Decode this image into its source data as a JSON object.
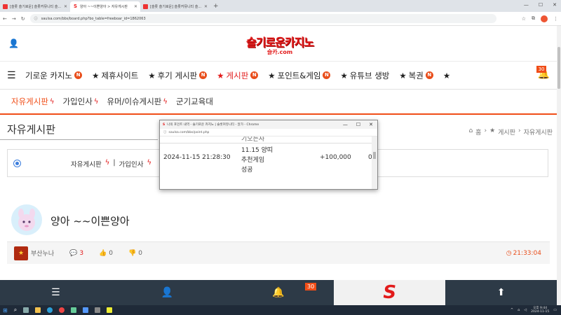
{
  "browser": {
    "tabs": [
      {
        "title": "[슬롯 슬기로운] 슬롯커뮤니티 슬...",
        "active": false,
        "favicon": "youtube-icon"
      },
      {
        "title": "양아 ~~이쁜양아 > 자유게시판",
        "active": true,
        "favicon": "s-logo-icon"
      },
      {
        "title": "[슬롯 슬기로운] 슬롯커뮤니티 슬...",
        "active": false,
        "favicon": "youtube-icon"
      }
    ],
    "url": "saulsa.com/bbs/board.php?bo_table=freeboar_id=1862063"
  },
  "site": {
    "logo_main": "슬기로운카지노",
    "logo_sub": "슬카.com"
  },
  "main_nav": [
    {
      "label": "기로운 카지노",
      "badge": "N",
      "star": false,
      "active": false
    },
    {
      "label": "제휴사이트",
      "badge": "",
      "star": true,
      "active": false
    },
    {
      "label": "후기 게시판",
      "badge": "N",
      "star": true,
      "active": false
    },
    {
      "label": "게시판",
      "badge": "N",
      "star": true,
      "active": true
    },
    {
      "label": "포인트&게임",
      "badge": "N",
      "star": true,
      "active": false
    },
    {
      "label": "유튜브 생방",
      "badge": "",
      "star": true,
      "active": false
    },
    {
      "label": "복권",
      "badge": "N",
      "star": true,
      "active": false
    }
  ],
  "notifications": {
    "count": "30"
  },
  "sub_nav": [
    {
      "label": "자유게시판",
      "active": true
    },
    {
      "label": "가입인사",
      "active": false
    },
    {
      "label": "유머/이슈게시판",
      "active": false
    },
    {
      "label": "군기교육대",
      "active": false
    }
  ],
  "board": {
    "title": "자유게시판",
    "breadcrumb": [
      "홈",
      "게시판",
      "자유게시판"
    ]
  },
  "filter": {
    "links": [
      "자유게시판",
      "가입인사"
    ],
    "separator": "|"
  },
  "post": {
    "title": "양아 ~~이쁜양아",
    "author": "부산누나",
    "comments": "3",
    "likes": "0",
    "dislikes": "0",
    "time": "21:33:04"
  },
  "popup": {
    "window_title": "나의 포인트 내역 - 슬기로운 카지노 | 슬롯커뮤니티 - 알가 - Chrome",
    "url": "saulsa.com/bbs/point.php",
    "cut_text": "기오는사",
    "row": {
      "date": "2024-11-15 21:28:30",
      "desc_lines": [
        "11.15 양띠",
        "추천게임",
        "성공"
      ],
      "amount": "+100,000",
      "extra": "0"
    }
  },
  "bottom_bar": {
    "badge": "30"
  },
  "taskbar": {
    "time": "오후 9:44",
    "date": "2024-11-15"
  },
  "colors": {
    "accent": "#f04d17",
    "brand_red": "#e21b1b",
    "bottom_bar": "#2d3a47"
  }
}
